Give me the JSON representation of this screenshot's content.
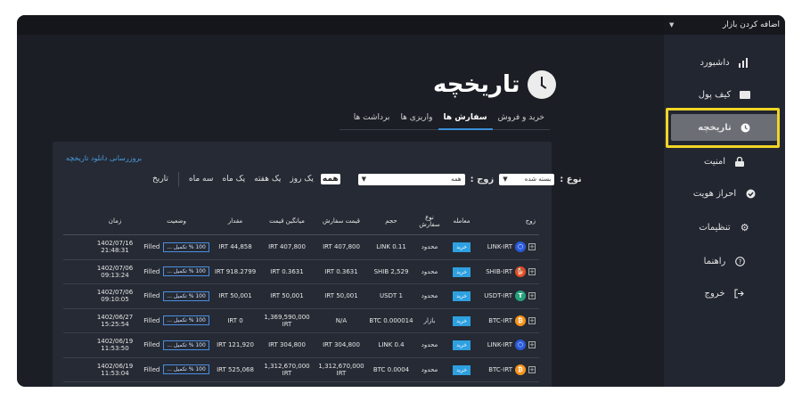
{
  "header": {
    "add_market": "اضافه کردن بازار"
  },
  "sidebar": {
    "items": [
      {
        "label": "داشبورد",
        "icon": "chart-bars-icon"
      },
      {
        "label": "کیف پول",
        "icon": "wallet-icon"
      },
      {
        "label": "تاریخچه",
        "icon": "history-icon"
      },
      {
        "label": "امنیت",
        "icon": "lock-icon"
      },
      {
        "label": "احراز هویت",
        "icon": "verified-badge-icon"
      },
      {
        "label": "تنظیمات",
        "icon": "gear-icon"
      },
      {
        "label": "راهنما",
        "icon": "help-icon"
      },
      {
        "label": "خروج",
        "icon": "logout-icon"
      }
    ],
    "active": "تاریخچه"
  },
  "page": {
    "title": "تاریخچه"
  },
  "tabs": [
    "خرید و فروش",
    "سفارش ها",
    "واریزی ها",
    "برداشت ها"
  ],
  "active_tab": "سفارش ها",
  "panel": {
    "refresh_link": "بروزرسانی دانلود تاریخچه",
    "type_label": "نوع :",
    "type_value": "بسته شده",
    "pair_label": "زوج :",
    "pair_value": "همه",
    "ranges": [
      "همه",
      "یک روز",
      "یک هفته",
      "یک ماه",
      "سه ماه",
      "تاریخ"
    ],
    "active_range": "همه"
  },
  "table": {
    "headers": [
      "زوج",
      "معامله",
      "نوع سفارش",
      "حجم",
      "قیمت سفارش",
      "میانگین قیمت",
      "مقدار",
      "وضعیت",
      "زمان"
    ],
    "rows": [
      {
        "pair": "LINK-IRT",
        "coin": "link",
        "side": "خرید",
        "type": "محدود",
        "volume": "LINK 0.11",
        "price": "IRT 407,800",
        "avg": "IRT 407,800",
        "amount": "IRT 44,858",
        "progress": "100 % تکمیل ...",
        "status": "Filled",
        "date": "1402/07/16",
        "time": "21:48:31"
      },
      {
        "pair": "SHIB-IRT",
        "coin": "shib",
        "side": "خرید",
        "type": "محدود",
        "volume": "SHIB 2,529",
        "price": "IRT 0.3631",
        "avg": "IRT 0.3631",
        "amount": "IRT 918.2799",
        "progress": "100 % تکمیل ...",
        "status": "Filled",
        "date": "1402/07/06",
        "time": "09:13:24"
      },
      {
        "pair": "USDT-IRT",
        "coin": "usdt",
        "side": "خرید",
        "type": "محدود",
        "volume": "USDT 1",
        "price": "IRT 50,001",
        "avg": "IRT 50,001",
        "amount": "IRT 50,001",
        "progress": "100 % تکمیل ...",
        "status": "Filled",
        "date": "1402/07/06",
        "time": "09:10:05"
      },
      {
        "pair": "BTC-IRT",
        "coin": "btc",
        "side": "خرید",
        "type": "بازار",
        "volume": "0.000014 BTC",
        "price": "N/A",
        "avg": "1,369,590,000 IRT",
        "amount": "IRT 0",
        "progress": "100 % تکمیل ...",
        "status": "Filled",
        "date": "1402/06/27",
        "time": "15:25:54"
      },
      {
        "pair": "LINK-IRT",
        "coin": "link",
        "side": "خرید",
        "type": "محدود",
        "volume": "LINK 0.4",
        "price": "IRT 304,800",
        "avg": "IRT 304,800",
        "amount": "IRT 121,920",
        "progress": "100 % تکمیل ...",
        "status": "Filled",
        "date": "1402/06/19",
        "time": "11:53:50"
      },
      {
        "pair": "BTC-IRT",
        "coin": "btc",
        "side": "خرید",
        "type": "محدود",
        "volume": "BTC 0.0004",
        "price": "1,312,670,000 IRT",
        "avg": "1,312,670,000 IRT",
        "amount": "IRT 525,068",
        "progress": "100 % تکمیل ...",
        "status": "Filled",
        "date": "1402/06/19",
        "time": "11:53:04"
      }
    ]
  },
  "colors": {
    "accent": "#2ea0e0",
    "highlight": "#f1d526",
    "background": "#1b1e25",
    "sidebar": "#222631"
  }
}
